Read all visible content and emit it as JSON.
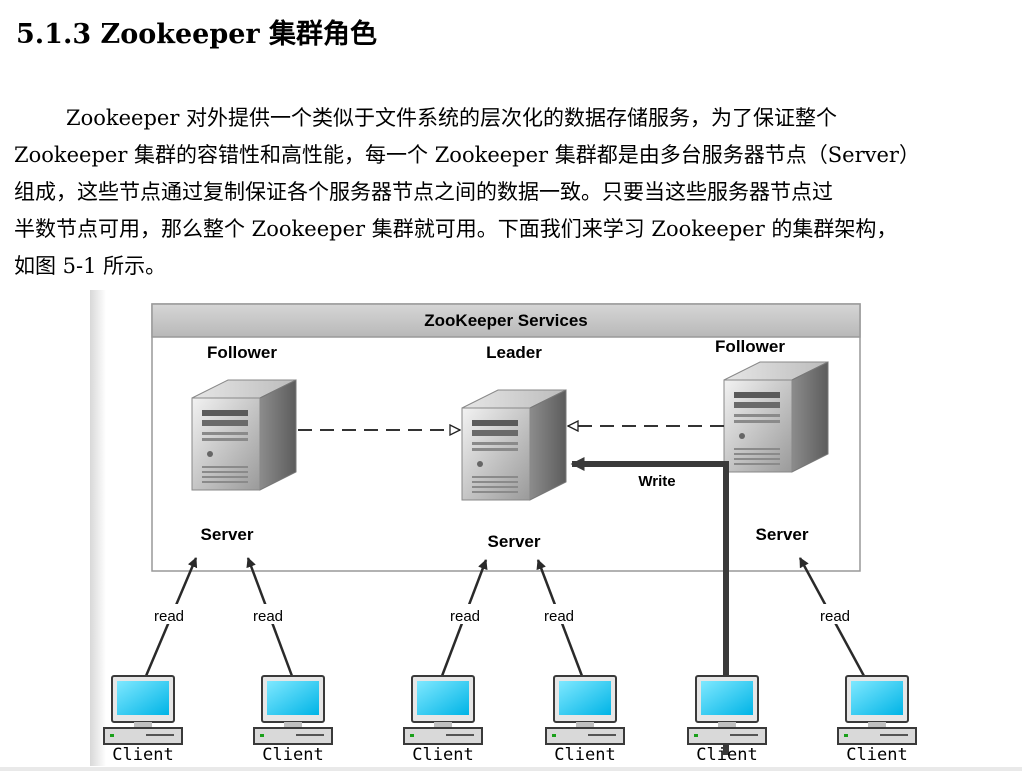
{
  "heading": "5.1.3  Zookeeper 集群角色",
  "paragraph_lines": [
    "Zookeeper 对外提供一个类似于文件系统的层次化的数据存储服务，为了保证整个",
    "Zookeeper 集群的容错性和高性能，每一个 Zookeeper 集群都是由多台服务器节点（Server）",
    "组成，这些节点通过复制保证各个服务器节点之间的数据一致。只要当这些服务器节点过",
    "半数节点可用，那么整个 Zookeeper 集群就可用。下面我们来学习 Zookeeper 的集群架构，",
    "如图 5-1 所示。"
  ],
  "diagram": {
    "services_title": "ZooKeeper Services",
    "servers": [
      {
        "role": "Follower",
        "label": "Server"
      },
      {
        "role": "Leader",
        "label": "Server"
      },
      {
        "role": "Follower",
        "label": "Server"
      }
    ],
    "write_label": "Write",
    "read_labels": [
      "read",
      "read",
      "read",
      "read",
      "read"
    ],
    "clients": [
      "Client",
      "Client",
      "Client",
      "Client",
      "Client",
      "Client"
    ]
  }
}
